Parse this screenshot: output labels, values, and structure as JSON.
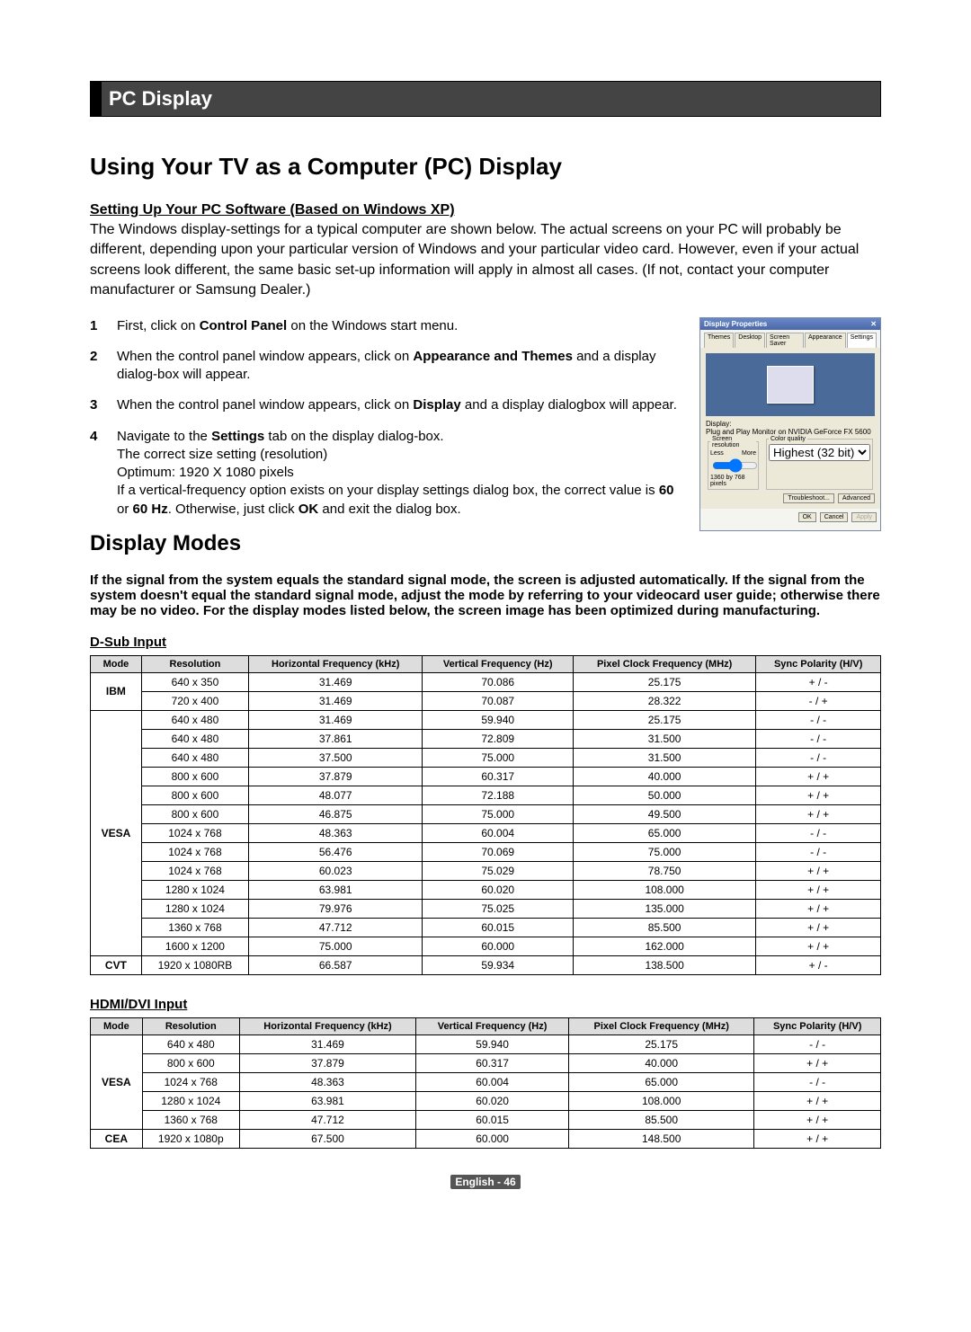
{
  "sectionHeader": "PC Display",
  "title": "Using Your TV as a Computer (PC) Display",
  "settingHeading": "Setting Up Your PC Software (Based on Windows XP)",
  "intro": "The Windows display-settings for a typical computer are shown below. The actual screens on your PC will probably be different, depending upon your particular version of Windows and your particular video card. However, even if your actual screens look different, the same basic set-up information will apply in almost all cases. (If not, contact your computer manufacturer or Samsung Dealer.)",
  "steps": {
    "s1_a": "First, click on ",
    "s1_b": "Control Panel",
    "s1_c": " on the Windows start menu.",
    "s2_a": "When the control panel window appears, click on ",
    "s2_b": "Appearance and Themes",
    "s2_c": " and a display dialog-box will appear.",
    "s3_a": "When the control panel window appears, click on ",
    "s3_b": "Display",
    "s3_c": " and a display dialogbox will appear.",
    "s4_a": "Navigate to the ",
    "s4_b": "Settings",
    "s4_c": " tab on the display dialog-box.",
    "s4_d": "The correct size setting (resolution)",
    "s4_e": "Optimum: 1920 X 1080 pixels",
    "s4_f": "If a vertical-frequency option exists on your display settings dialog box, the correct value is ",
    "s4_g": "60",
    "s4_h": " or ",
    "s4_i": "60 Hz",
    "s4_j": ". Otherwise, just click ",
    "s4_k": "OK",
    "s4_l": " and exit the dialog box."
  },
  "dispprop": {
    "title": "Display Properties",
    "tabThemes": "Themes",
    "tabDesktop": "Desktop",
    "tabScreenSaver": "Screen Saver",
    "tabAppearance": "Appearance",
    "tabSettings": "Settings",
    "displayLabel": "Display:",
    "displayValue": "Plug and Play Monitor on NVIDIA GeForce FX 5600",
    "resLegend": "Screen resolution",
    "resLess": "Less",
    "resMore": "More",
    "resValue": "1360 by 768 pixels",
    "qualLegend": "Color quality",
    "qualValue": "Highest (32 bit)",
    "btnTroubleshoot": "Troubleshoot...",
    "btnAdvanced": "Advanced",
    "btnOK": "OK",
    "btnCancel": "Cancel",
    "btnApply": "Apply"
  },
  "modesHeading": "Display Modes",
  "modesIntro": "If the signal from the system equals the standard signal mode, the screen is adjusted automatically. If the signal from the system doesn't equal the standard signal mode, adjust the mode by referring to your videocard user guide; otherwise there may be no video. For the display modes listed below, the screen image has been optimized during manufacturing.",
  "tableHeaders": {
    "mode": "Mode",
    "res": "Resolution",
    "hfreq": "Horizontal Frequency (kHz)",
    "vfreq": "Vertical Frequency (Hz)",
    "pclk": "Pixel Clock Frequency (MHz)",
    "sync": "Sync Polarity (H/V)"
  },
  "dsubHeading": "D-Sub Input",
  "dsubGroups": [
    {
      "mode": "IBM",
      "rows": [
        {
          "res": "640 x 350",
          "h": "31.469",
          "v": "70.086",
          "p": "25.175",
          "s": "+ / -"
        },
        {
          "res": "720 x 400",
          "h": "31.469",
          "v": "70.087",
          "p": "28.322",
          "s": "- / +"
        }
      ]
    },
    {
      "mode": "VESA",
      "rows": [
        {
          "res": "640 x 480",
          "h": "31.469",
          "v": "59.940",
          "p": "25.175",
          "s": "- / -"
        },
        {
          "res": "640 x 480",
          "h": "37.861",
          "v": "72.809",
          "p": "31.500",
          "s": "- / -"
        },
        {
          "res": "640 x 480",
          "h": "37.500",
          "v": "75.000",
          "p": "31.500",
          "s": "- / -"
        },
        {
          "res": "800 x 600",
          "h": "37.879",
          "v": "60.317",
          "p": "40.000",
          "s": "+ / +"
        },
        {
          "res": "800 x 600",
          "h": "48.077",
          "v": "72.188",
          "p": "50.000",
          "s": "+ / +"
        },
        {
          "res": "800 x 600",
          "h": "46.875",
          "v": "75.000",
          "p": "49.500",
          "s": "+ / +"
        },
        {
          "res": "1024 x 768",
          "h": "48.363",
          "v": "60.004",
          "p": "65.000",
          "s": "- / -"
        },
        {
          "res": "1024 x 768",
          "h": "56.476",
          "v": "70.069",
          "p": "75.000",
          "s": "- / -"
        },
        {
          "res": "1024 x 768",
          "h": "60.023",
          "v": "75.029",
          "p": "78.750",
          "s": "+ / +"
        },
        {
          "res": "1280 x 1024",
          "h": "63.981",
          "v": "60.020",
          "p": "108.000",
          "s": "+ / +"
        },
        {
          "res": "1280 x 1024",
          "h": "79.976",
          "v": "75.025",
          "p": "135.000",
          "s": "+ / +"
        },
        {
          "res": "1360 x 768",
          "h": "47.712",
          "v": "60.015",
          "p": "85.500",
          "s": "+ / +"
        },
        {
          "res": "1600 x 1200",
          "h": "75.000",
          "v": "60.000",
          "p": "162.000",
          "s": "+ / +"
        }
      ]
    },
    {
      "mode": "CVT",
      "rows": [
        {
          "res": "1920 x 1080RB",
          "h": "66.587",
          "v": "59.934",
          "p": "138.500",
          "s": "+ / -"
        }
      ]
    }
  ],
  "hdmiHeading": "HDMI/DVI Input",
  "hdmiGroups": [
    {
      "mode": "VESA",
      "rows": [
        {
          "res": "640 x 480",
          "h": "31.469",
          "v": "59.940",
          "p": "25.175",
          "s": "- / -"
        },
        {
          "res": "800 x 600",
          "h": "37.879",
          "v": "60.317",
          "p": "40.000",
          "s": "+ / +"
        },
        {
          "res": "1024 x 768",
          "h": "48.363",
          "v": "60.004",
          "p": "65.000",
          "s": "- / -"
        },
        {
          "res": "1280 x 1024",
          "h": "63.981",
          "v": "60.020",
          "p": "108.000",
          "s": "+ / +"
        },
        {
          "res": "1360 x 768",
          "h": "47.712",
          "v": "60.015",
          "p": "85.500",
          "s": "+ / +"
        }
      ]
    },
    {
      "mode": "CEA",
      "rows": [
        {
          "res": "1920 x 1080p",
          "h": "67.500",
          "v": "60.000",
          "p": "148.500",
          "s": "+ / +"
        }
      ]
    }
  ],
  "footerLang": "English - ",
  "footerPage": "46"
}
